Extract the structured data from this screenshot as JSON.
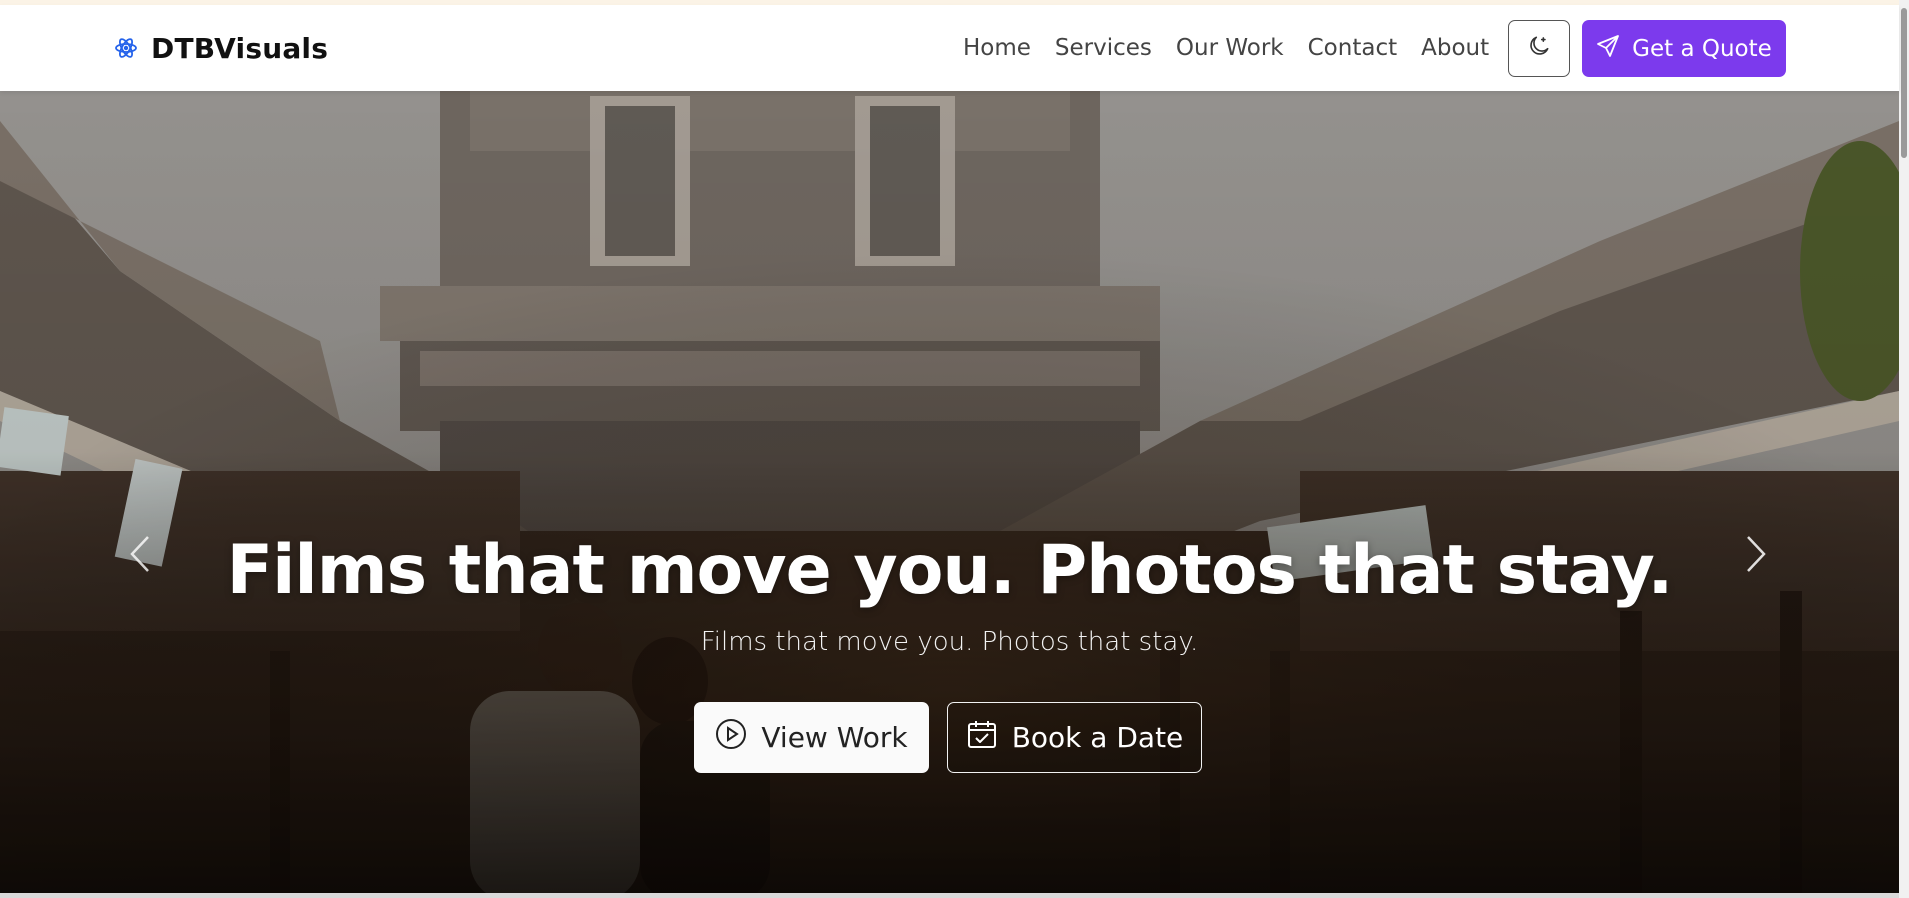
{
  "brand": {
    "name": "DTBVisuals",
    "icon": "atom-icon"
  },
  "nav": {
    "links": [
      {
        "label": "Home"
      },
      {
        "label": "Services"
      },
      {
        "label": "Our Work"
      },
      {
        "label": "Contact"
      },
      {
        "label": "About"
      }
    ],
    "theme_toggle_icon": "moon-icon",
    "cta": {
      "label": "Get a Quote",
      "icon": "send-icon"
    }
  },
  "hero": {
    "title": "Films that move you. Photos that stay.",
    "subtitle": "Films that move you. Photos that stay.",
    "buttons": {
      "primary": {
        "label": "View Work",
        "icon": "play-circle-icon"
      },
      "secondary": {
        "label": "Book a Date",
        "icon": "calendar-check-icon"
      }
    },
    "prev_icon": "chevron-left-icon",
    "next_icon": "chevron-right-icon"
  },
  "colors": {
    "accent": "#7c3aed",
    "brand_icon": "#2563eb"
  }
}
